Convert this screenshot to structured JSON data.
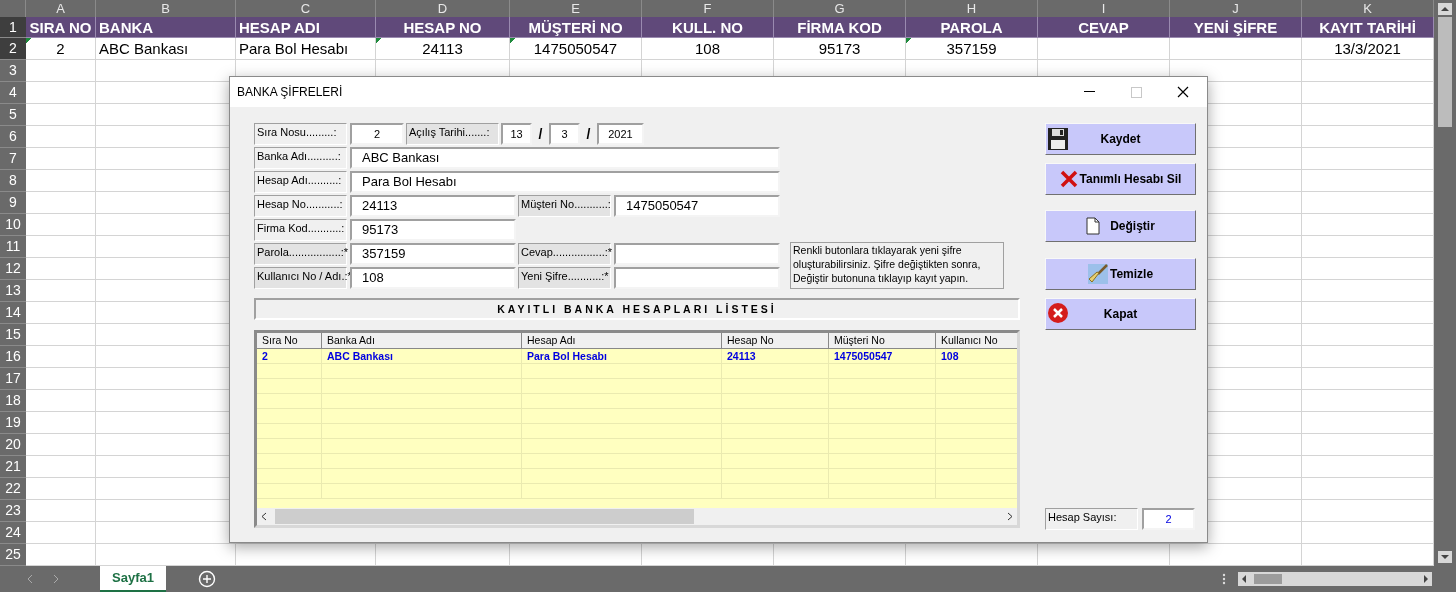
{
  "sheet": {
    "column_letters": [
      "A",
      "B",
      "C",
      "D",
      "E",
      "F",
      "G",
      "H",
      "I",
      "J",
      "K"
    ],
    "row_numbers": [
      "1",
      "2",
      "3",
      "4",
      "5",
      "6",
      "7",
      "8",
      "9",
      "10",
      "11",
      "12",
      "13",
      "14",
      "15",
      "16",
      "17",
      "18",
      "19",
      "20",
      "21",
      "22",
      "23",
      "24",
      "25"
    ],
    "header_row": [
      "SIRA NO",
      "BANKA",
      "HESAP ADI",
      "HESAP NO",
      "MÜŞTERİ NO",
      "KULL. NO",
      "FİRMA KOD",
      "PAROLA",
      "CEVAP",
      "YENİ ŞİFRE",
      "KAYIT TARİHİ"
    ],
    "data_row": [
      {
        "text": "2",
        "flagged": true
      },
      {
        "text": "ABC Bankası",
        "flagged": false
      },
      {
        "text": "Para Bol Hesabı",
        "flagged": false
      },
      {
        "text": "24113",
        "flagged": true
      },
      {
        "text": "1475050547",
        "flagged": true
      },
      {
        "text": "108",
        "flagged": false
      },
      {
        "text": "95173",
        "flagged": false
      },
      {
        "text": "357159",
        "flagged": true
      },
      {
        "flagged": false
      },
      {
        "flagged": false
      },
      {
        "text": "13/3/2021",
        "flagged": false
      }
    ]
  },
  "dialog": {
    "title": "BANKA ŞİFRELERİ",
    "form": {
      "sira_no": {
        "label": "Sıra Nosu.........:",
        "value": "2"
      },
      "acilis_tarihi": {
        "label": "Açılış Tarihi.......:",
        "day": "13",
        "month": "3",
        "year": "2021",
        "separators": [
          "/",
          "/"
        ]
      },
      "banka_adi": {
        "label": "Banka Adı..........:",
        "value": "ABC Bankası"
      },
      "hesap_adi": {
        "label": "Hesap Adı..........:",
        "value": "Para Bol Hesabı"
      },
      "hesap_no": {
        "label": "Hesap No...........:",
        "value": "24113"
      },
      "musteri_no": {
        "label": "Müşteri No...........:",
        "value": "1475050547"
      },
      "firma_kod": {
        "label": "Firma Kod...........:",
        "value": "95173"
      },
      "parola": {
        "label": "Parola.................:*",
        "value": "357159"
      },
      "cevap": {
        "label": "Cevap.................:*"
      },
      "kullanici_no": {
        "label": "Kullanıcı No / Adı.:*",
        "value": "108"
      },
      "yeni_sifre": {
        "label": "Yeni Şifre...........:*"
      }
    },
    "info": "Renkli butonlara tıklayarak yeni şifre oluşturabilirsiniz. Şifre değiştikten sonra, Değiştir butonuna tıklayıp kayıt yapın.",
    "list_title": "KAYITLI BANKA HESAPLARI LİSTESİ",
    "table": {
      "columns": [
        "Sıra No",
        "Banka Adı",
        "Hesap Adı",
        "Hesap No",
        "Müşteri No",
        "Kullanıcı No"
      ],
      "rows": [
        [
          "2",
          "ABC Bankası",
          "Para Bol Hesabı",
          "24113",
          "1475050547",
          "108"
        ]
      ]
    },
    "buttons": [
      "Kaydet",
      "Tanımlı Hesabı Sil",
      "Değiştir",
      "Temizle",
      "Kapat"
    ],
    "count": {
      "label": "Hesap Sayısı:",
      "value": "2"
    }
  },
  "sheet_tabs": [
    {
      "label": "Sayfa1",
      "selected": true
    }
  ]
}
